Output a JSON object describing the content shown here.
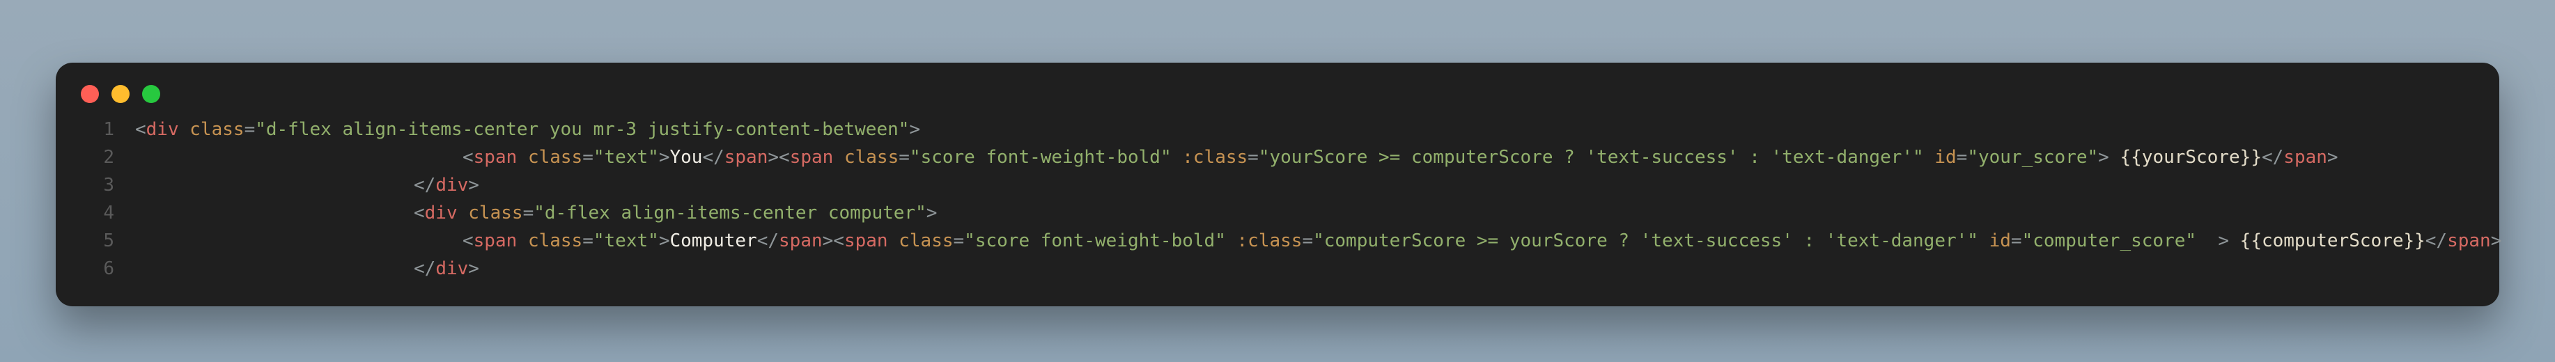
{
  "lines": {
    "n1": "1",
    "n2": "2",
    "n3": "3",
    "n4": "4",
    "n5": "5",
    "n6": "6"
  },
  "l1": {
    "open": "<",
    "tag": "div",
    "sp": " ",
    "attr_class": "class",
    "eq": "=",
    "q": "\"",
    "class_val": "d-flex align-items-center you mr-3 justify-content-between",
    "close": ">"
  },
  "l2": {
    "open": "<",
    "span": "span",
    "sp": " ",
    "attr_class": "class",
    "eq": "=",
    "q": "\"",
    "cls_text": "text",
    "close": ">",
    "txt_you": "You",
    "lt_sl": "</",
    "cls_score": "score font-weight-bold",
    "attr_dclass": ":class",
    "dclass_val": "yourScore >= computerScore ? 'text-success' : 'text-danger'",
    "attr_id": "id",
    "id_val": "your_score",
    "bind": " {{yourScore}}"
  },
  "l3": {
    "lt_sl": "</",
    "div": "div",
    "close": ">"
  },
  "l4": {
    "open": "<",
    "div": "div",
    "sp": " ",
    "attr_class": "class",
    "eq": "=",
    "q": "\"",
    "class_val": "d-flex align-items-center computer",
    "close": ">"
  },
  "l5": {
    "open": "<",
    "span": "span",
    "sp": " ",
    "attr_class": "class",
    "eq": "=",
    "q": "\"",
    "cls_text": "text",
    "close": ">",
    "txt_comp": "Computer",
    "lt_sl": "</",
    "cls_score": "score font-weight-bold",
    "attr_dclass": ":class",
    "dclass_val": "computerScore >= yourScore ? 'text-success' : 'text-danger'",
    "attr_id": "id",
    "id_val": "computer_score",
    "extra_sp": "  ",
    "bind": " {{computerScore}}"
  },
  "l6": {
    "lt_sl": "</",
    "div": "div",
    "close": ">"
  }
}
